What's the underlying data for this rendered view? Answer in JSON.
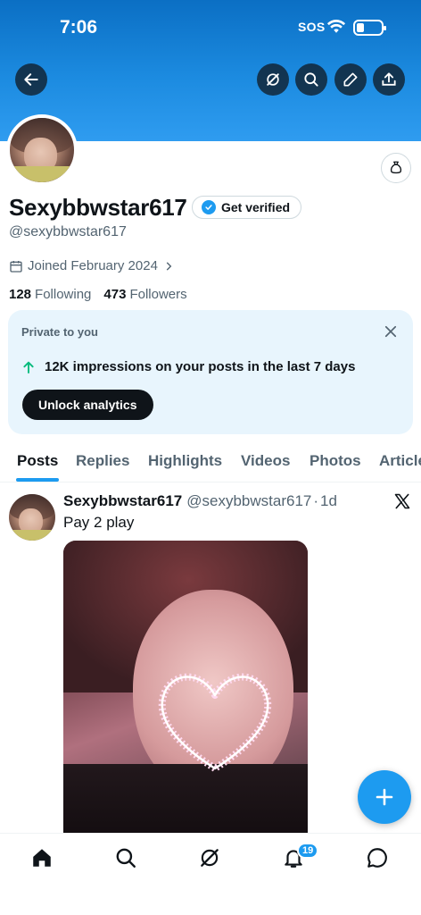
{
  "status_bar": {
    "time": "7:06",
    "sos": "SOS"
  },
  "header": {
    "back_icon": "arrow-left-icon",
    "actions": [
      "grok-icon",
      "search-icon",
      "pencil-icon",
      "share-icon"
    ]
  },
  "profile": {
    "display_name": "Sexybbwstar617",
    "get_verified_label": "Get verified",
    "handle": "@sexybbwstar617",
    "joined": "Joined February 2024",
    "following_count": "128",
    "following_label": "Following",
    "followers_count": "473",
    "followers_label": "Followers"
  },
  "analytics_card": {
    "title": "Private to you",
    "stat_text": "12K impressions on your posts in the last 7 days",
    "button_label": "Unlock analytics"
  },
  "tabs": [
    {
      "label": "Posts",
      "active": true
    },
    {
      "label": "Replies"
    },
    {
      "label": "Highlights"
    },
    {
      "label": "Videos"
    },
    {
      "label": "Photos"
    },
    {
      "label": "Articles"
    }
  ],
  "post": {
    "author_name": "Sexybbwstar617",
    "author_handle": "@sexybbwstar617",
    "separator": "·",
    "time_ago": "1d",
    "text": "Pay 2 play"
  },
  "bottom_nav": {
    "items": [
      "home-icon",
      "search-icon",
      "grok-icon",
      "notifications-icon",
      "messages-icon"
    ],
    "notifications_badge": "19"
  },
  "colors": {
    "accent": "#1d9bf0",
    "text_primary": "#0f1419",
    "text_secondary": "#536471",
    "card_bg": "#e8f5fd"
  }
}
